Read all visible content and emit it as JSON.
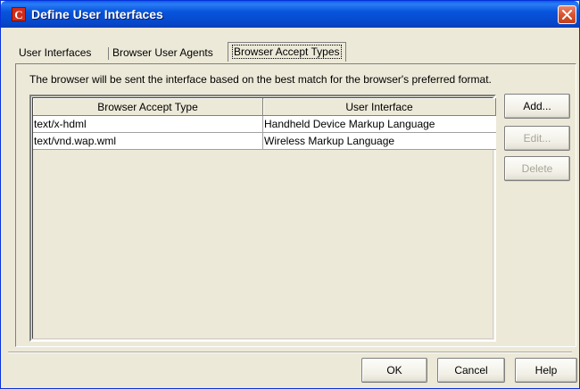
{
  "window": {
    "title": "Define User Interfaces",
    "title_icon_letter": "C",
    "titlebar_color": "#0855dd",
    "close_icon": "close-icon"
  },
  "tabs": [
    {
      "label": "User Interfaces",
      "active": false
    },
    {
      "label": "Browser User Agents",
      "active": false
    },
    {
      "label": "Browser Accept Types",
      "active": true
    }
  ],
  "description": "The browser will be sent the interface based on the best match for the browser's preferred format.",
  "table": {
    "columns": [
      "Browser Accept Type",
      "User Interface"
    ],
    "rows": [
      {
        "accept_type": "text/x-hdml",
        "user_interface": "Handheld Device Markup Language"
      },
      {
        "accept_type": "text/vnd.wap.wml",
        "user_interface": "Wireless Markup Language"
      }
    ]
  },
  "side_buttons": {
    "add": {
      "label": "Add...",
      "enabled": true
    },
    "edit": {
      "label": "Edit...",
      "enabled": false
    },
    "delete": {
      "label": "Delete",
      "enabled": false
    }
  },
  "footer_buttons": {
    "ok": "OK",
    "cancel": "Cancel",
    "help": "Help"
  }
}
